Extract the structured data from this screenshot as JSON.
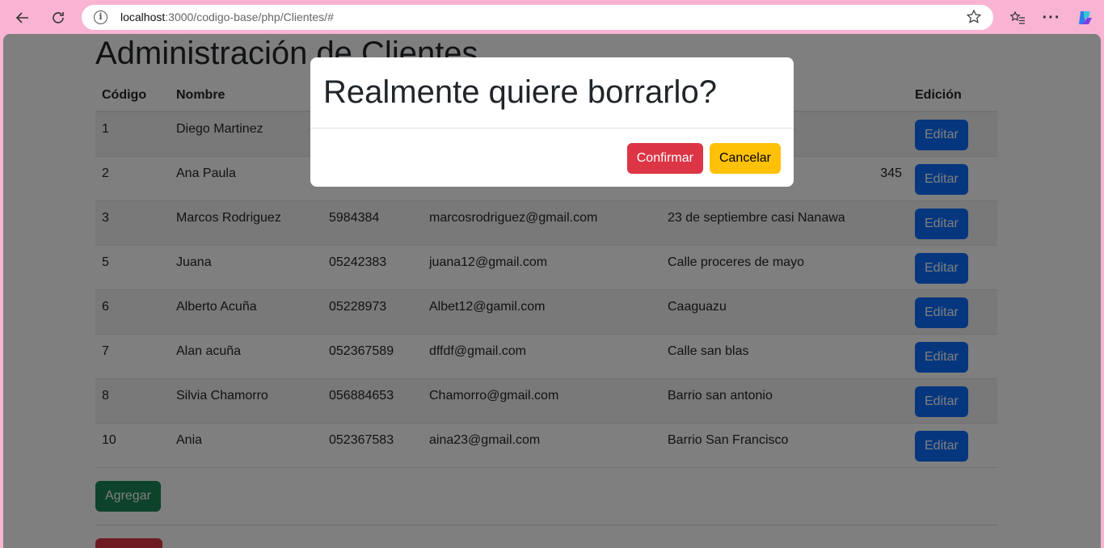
{
  "browser": {
    "url_host": "localhost",
    "url_rest": ":3000/codigo-base/php/Clientes/#"
  },
  "page": {
    "title": "Administración de Clientes",
    "columns": {
      "codigo": "Código",
      "nombre": "Nombre",
      "edicion": "Edición"
    },
    "rows": [
      {
        "codigo": "1",
        "nombre": "Diego Martinez",
        "telefono": "",
        "email": "",
        "direccion": ""
      },
      {
        "codigo": "2",
        "nombre": "Ana Paula",
        "telefono": "",
        "email": "",
        "direccion": "345"
      },
      {
        "codigo": "3",
        "nombre": "Marcos Rodriguez",
        "telefono": "5984384",
        "email": "marcosrodriguez@gmail.com",
        "direccion": "23 de septiembre casi Nanawa"
      },
      {
        "codigo": "5",
        "nombre": "Juana",
        "telefono": "05242383",
        "email": "juana12@gmail.com",
        "direccion": "Calle proceres de mayo"
      },
      {
        "codigo": "6",
        "nombre": "Alberto Acuña",
        "telefono": "05228973",
        "email": "Albet12@gamil.com",
        "direccion": "Caaguazu"
      },
      {
        "codigo": "7",
        "nombre": "Alan acuña",
        "telefono": "052367589",
        "email": "dffdf@gmail.com",
        "direccion": "Calle san blas"
      },
      {
        "codigo": "8",
        "nombre": "Silvia Chamorro",
        "telefono": "056884653",
        "email": "Chamorro@gmail.com",
        "direccion": "Barrio san antonio"
      },
      {
        "codigo": "10",
        "nombre": "Ania",
        "telefono": "052367583",
        "email": "aina23@gmail.com",
        "direccion": "Barrio San Francisco"
      }
    ],
    "edit_label": "Editar",
    "add_label": "Agregar"
  },
  "modal": {
    "title": "Realmente quiere borrarlo?",
    "confirm_label": "Confirmar",
    "cancel_label": "Cancelar"
  },
  "colors": {
    "primary": "#0d6efd",
    "success": "#198754",
    "danger": "#dc3545",
    "warning": "#ffc107",
    "chrome": "#f9b4d4"
  }
}
